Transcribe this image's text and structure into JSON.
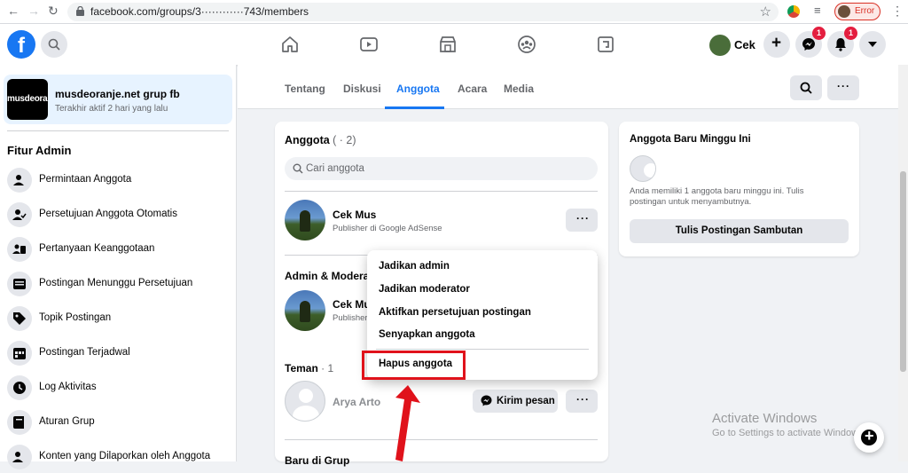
{
  "browser": {
    "url": "facebook.com/groups/3············743/members",
    "error_label": "Error"
  },
  "topbar": {
    "user_name": "Cek",
    "messenger_badge": "1",
    "notif_badge": "1"
  },
  "sidebar": {
    "group_thumb_text": "musdeoranje",
    "group_name": "musdeoranje.net grup fb",
    "group_sub": "Terakhir aktif 2 hari yang lalu",
    "section_title": "Fitur Admin",
    "items": [
      {
        "label": "Permintaan Anggota"
      },
      {
        "label": "Persetujuan Anggota Otomatis"
      },
      {
        "label": "Pertanyaan Keanggotaan"
      },
      {
        "label": "Postingan Menunggu Persetujuan"
      },
      {
        "label": "Topik Postingan"
      },
      {
        "label": "Postingan Terjadwal"
      },
      {
        "label": "Log Aktivitas"
      },
      {
        "label": "Aturan Grup"
      },
      {
        "label": "Konten yang Dilaporkan oleh Anggota"
      }
    ]
  },
  "tabs": [
    {
      "label": "Tentang"
    },
    {
      "label": "Diskusi"
    },
    {
      "label": "Anggota"
    },
    {
      "label": "Acara"
    },
    {
      "label": "Media"
    }
  ],
  "members": {
    "title": "Anggota",
    "count": " · 2)",
    "title_open": " (",
    "search_placeholder": "Cari anggota",
    "owner": {
      "name": "Cek Mus",
      "sub": "Publisher di Google AdSense"
    },
    "admin_section": "Admin & Moderator",
    "admin": {
      "name": "Cek Mus",
      "sub": "Publisher di Google AdSense"
    },
    "friends_section": "Teman",
    "friends_count": " · 1",
    "friend": {
      "name": "Arya Arto"
    },
    "message_button": "Kirim pesan",
    "new_section": "Baru di Grup"
  },
  "dropdown": {
    "items": [
      {
        "label": "Jadikan admin"
      },
      {
        "label": "Jadikan moderator"
      },
      {
        "label": "Aktifkan persetujuan postingan"
      },
      {
        "label": "Senyapkan anggota"
      },
      {
        "label": "Hapus anggota"
      }
    ]
  },
  "new_members": {
    "title": "Anggota Baru Minggu Ini",
    "description": "Anda memiliki 1 anggota baru minggu ini. Tulis postingan untuk menyambutnya.",
    "button": "Tulis Postingan Sambutan"
  },
  "watermark": {
    "line1": "Activate Windows",
    "line2": "Go to Settings to activate Windows."
  },
  "colors": {
    "accent": "#1877f2",
    "highlight": "#e0121b"
  }
}
